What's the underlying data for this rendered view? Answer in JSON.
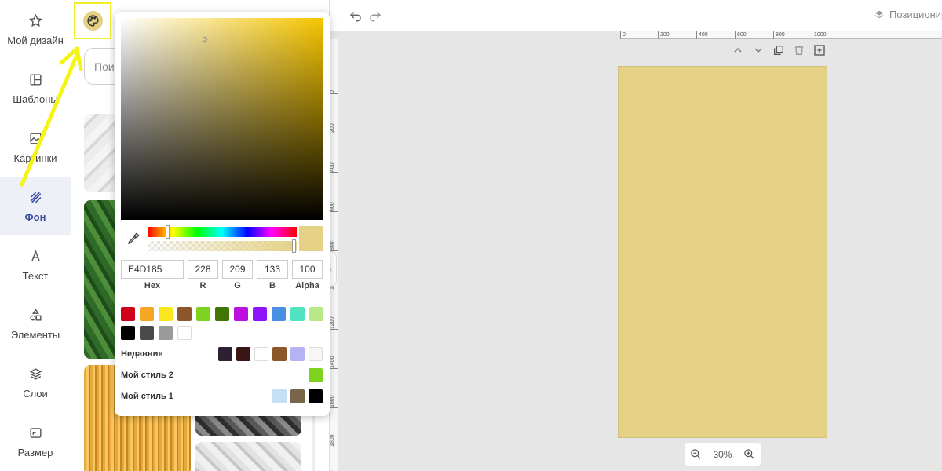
{
  "sidebar": {
    "items": [
      {
        "label": "Мой дизайн",
        "icon": "star-icon"
      },
      {
        "label": "Шаблоны",
        "icon": "template-icon"
      },
      {
        "label": "Картинки",
        "icon": "image-icon"
      },
      {
        "label": "Фон",
        "icon": "background-stripes-icon"
      },
      {
        "label": "Текст",
        "icon": "text-icon"
      },
      {
        "label": "Элементы",
        "icon": "shapes-icon"
      },
      {
        "label": "Слои",
        "icon": "layers-icon"
      },
      {
        "label": "Размер",
        "icon": "resize-icon"
      }
    ]
  },
  "panel": {
    "search_placeholder": "Поис"
  },
  "picker": {
    "hex_value": "E4D185",
    "r_value": "228",
    "g_value": "209",
    "b_value": "133",
    "alpha_value": "100",
    "hex_label": "Hex",
    "r_label": "R",
    "g_label": "G",
    "b_label": "B",
    "alpha_label": "Alpha",
    "preset_colors_row1": [
      "#d0021b",
      "#f5a623",
      "#f8e71c",
      "#8b572a",
      "#7ed321",
      "#417505",
      "#bd10e0",
      "#9013fe",
      "#4a90e2",
      "#50e3c2",
      "#b8e986"
    ],
    "preset_colors_row2": [
      "#000000",
      "#4a4a4a",
      "#9b9b9b",
      "#ffffff"
    ],
    "recent_label": "Недавние",
    "recent_colors": [
      "#2e1f33",
      "#3b1414",
      "#ffffff",
      "#8b572a",
      "#b3b3f5",
      "#f8f5f7"
    ],
    "style2_label": "Мой стиль 2",
    "style2_colors": [
      "#7ed321"
    ],
    "style1_label": "Мой стиль 1",
    "style1_colors": [
      "#c5dff5",
      "#7b6548",
      "#000000"
    ]
  },
  "topbar": {
    "position_label": "Позиционир"
  },
  "ruler": {
    "top_ticks": [
      "0",
      "200",
      "400",
      "600",
      "800",
      "1000"
    ],
    "left_ticks": [
      "0",
      "200",
      "400",
      "600",
      "800",
      "1000",
      "1200",
      "1400",
      "1600",
      "1800",
      "2000"
    ]
  },
  "zoom": {
    "level": "30%"
  },
  "colors": {
    "background": "#e4d185",
    "accent": "#3b4a9c",
    "highlight": "#f2ee2a"
  }
}
